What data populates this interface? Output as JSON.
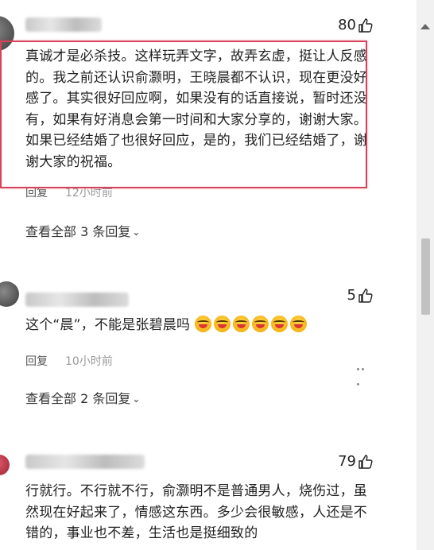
{
  "comments": [
    {
      "likes": "80",
      "text": "真诚才是必杀技。这样玩弄文字，故弄玄虚，挺让人反感的。我之前还认识俞灏明，王晓晨都不认识，现在更没好感了。其实很好回应啊，如果没有的话直接说，暂时还没有，如果有好消息会第一时间和大家分享的，谢谢大家。如果已经结婚了也很好回应，是的，我们已经结婚了，谢谢大家的祝福。",
      "reply_label": "回复",
      "time": "12小时前",
      "expand_label": "查看全部 3 条回复"
    },
    {
      "likes": "5",
      "text": "这个“晨”，不能是张碧晨吗",
      "reply_label": "回复",
      "time": "10小时前",
      "expand_label": "查看全部 2 条回复"
    },
    {
      "likes": "79",
      "text": "行就行。不行就不行，俞灏明不是普通男人，烧伤过，虽然现在好起来了，情感这东西。多少会很敏感，人还是不错的，事业也不差，生活也是挺细致的"
    }
  ],
  "icons": {
    "like": "thumbs-up-icon",
    "more": "more-dots-icon",
    "expand": "chevron-down-icon",
    "emoji": "laughing-crying-emoji"
  },
  "colors": {
    "highlight_border": "#d9405a",
    "text": "#222222",
    "meta": "#9a9a9a"
  }
}
